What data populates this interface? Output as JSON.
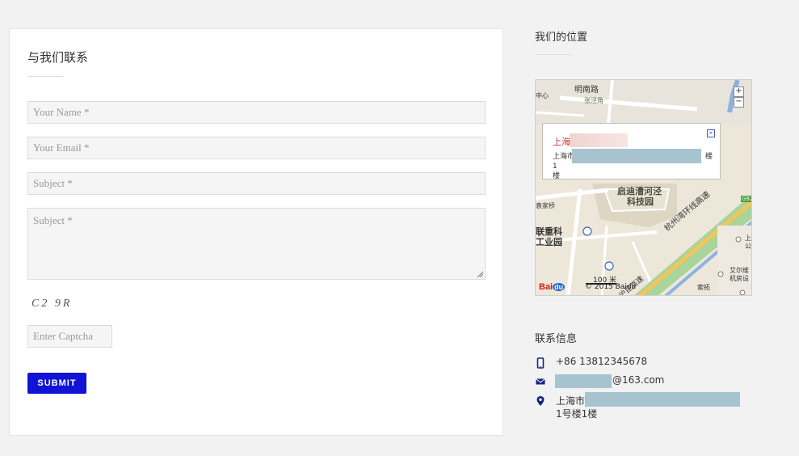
{
  "contact_form": {
    "title": "与我们联系",
    "name_placeholder": "Your Name *",
    "email_placeholder": "Your Email *",
    "subject_placeholder": "Subject *",
    "message_placeholder": "Subject *",
    "captcha_text": "C2 9R",
    "captcha_placeholder": "Enter Captcha",
    "submit_label": "SUBMIT"
  },
  "location": {
    "title": "我们的位置",
    "map": {
      "labels": {
        "road_north": "明南路",
        "area_1": "张泾角",
        "edge_center": "中心",
        "park": "启迪漕河泾",
        "park_2": "科技园",
        "village": "袁家桥",
        "industrial_1": "联重科",
        "industrial_2": "工业园",
        "highway": "杭州湾环线高速",
        "highway_2": "沪昆高速",
        "right_1": "上",
        "right_2": "公",
        "shop": "艾尔维",
        "shop_2": "机房设",
        "index": "索拓",
        "shield": "G92"
      },
      "popup": {
        "name": "上海",
        "address_start": "上海市",
        "address_end": "楼1",
        "address_line2": "楼"
      },
      "zoom_in": "+",
      "zoom_out": "−",
      "scale": "100 米",
      "copyright": "© 2015 Baidu",
      "logo": "Bai",
      "logo_badge": "du",
      "close": "×"
    }
  },
  "contact_info": {
    "title": "联系信息",
    "phone": "+86 13812345678",
    "email_suffix": "@163.com",
    "address_line1": "上海市",
    "address_line2": "1号楼1楼"
  },
  "colors": {
    "accent": "#1114d4",
    "icon": "#1a237e",
    "redaction": "#a7c3d0"
  }
}
